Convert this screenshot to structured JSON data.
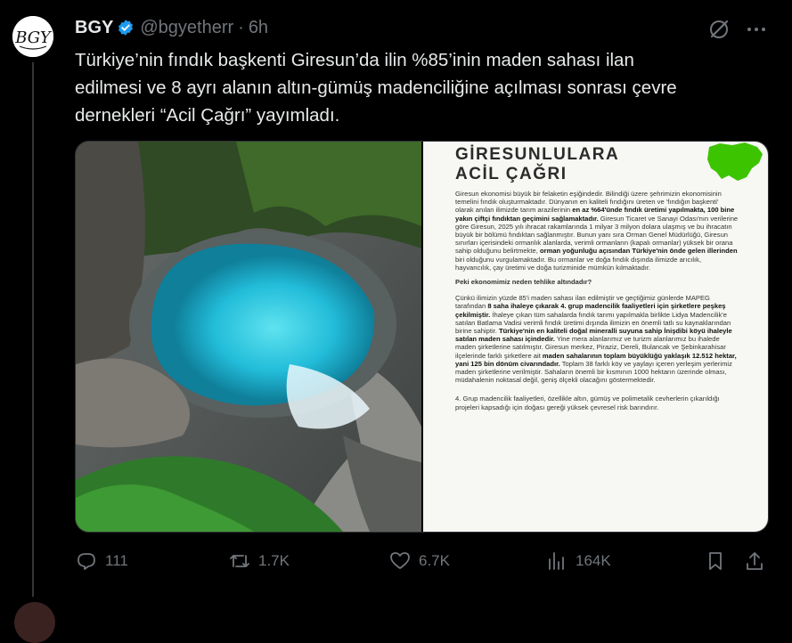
{
  "post": {
    "author_name": "BGY",
    "author_handle": "@bgyetherr",
    "separator": "·",
    "time": "6h",
    "text": "Türkiye’nin fındık başkenti Giresun’da ilin %85’inin maden sahası ilan\nedilmesi ve 8 ayrı alanın altın-gümüş madenciliğine açılması sonrası çevre\ndernekleri “Acil Çağrı” yayımladı.",
    "icons": {
      "grok": "grok-icon",
      "more": "more-icon",
      "verified": "verified-badge-icon"
    }
  },
  "document": {
    "title_line1": "GİRESUNLULARA",
    "title_line2": "ACİL ÇAĞRI",
    "p1_a": "Giresun ekonomisi büyük bir felaketin eşiğindedir. Bilindiği üzere şehrimizin ekonomisinin temelini fındık oluşturmaktadır. Dünyanın en kaliteli fındığını üreten ve 'fındığın başkenti' olarak anılan ilimizde tarım arazilerinin ",
    "p1_b": "en az %64'ünde fındık üretimi yapılmakta, 100 bine yakın çiftçi fındıktan geçimini sağlamaktadır.",
    "p1_c": " Giresun Ticaret ve Sanayi Odası'nın verilerine göre Giresun, 2025 yılı ihracat rakamlarında 1 milyar 3 milyon dolara ulaşmış ve bu ihracatın büyük bir bölümü fındıktan sağlanmıştır. Bunun yanı sıra Orman Genel Müdürlüğü, Giresun sınırları içerisindeki ormanlık alanlarda, verimli ormanların (kapalı ormanlar) yüksek bir orana sahip olduğunu belirtmekte, ",
    "p1_d": "orman yoğunluğu açısından Türkiye'nin önde gelen illerinden",
    "p1_e": " biri olduğunu vurgulamaktadır. Bu ormanlar ve doğa fındık dışında ilimizde arıcılık, hayvancılık, çay üretimi ve doğa turizminide mümkün kılmaktadır.",
    "question": "Peki ekonomimiz neden tehlike altındadır?",
    "p2_a": "Çünkü ilimizin yüzde 85'i maden sahası ilan edilmiştir ve geçtiğimiz günlerde MAPEG tarafından ",
    "p2_b": "8 saha ihaleye çıkarak 4. grup madencilik faaliyetleri için şirketlere peşkeş çekilmiştir.",
    "p2_c": " İhaleye çıkan tüm sahalarda fındık tarımı yapılmakla birlikte Lidya Madencilik'e satılan Batlama Vadisi verimli fındık üretimi dışında ilimizin en önemli tatlı su kaynaklarından birine sahiptir. ",
    "p2_d": "Türkiye'nin en kaliteli doğal mineralli suyuna sahip İnişdibi köyü ihaleyle satılan maden sahası içindedir.",
    "p2_e": " Yine mera alanlarımız ve turizm alanlarımız bu ihalede maden şirketlerine satılmıştır. Giresun merkez, Piraziz, Dereli, Bulancak ve Şebinkarahisar ilçelerinde farklı şirketlere ait ",
    "p2_f": "maden sahalarının toplam büyüklüğü yaklaşık 12.512 hektar, yani 125 bin dönüm civarındadır.",
    "p2_g": " Toplam 38 farklı köy ve yaylayı içeren yerleşim yerlerimiz maden şirketlerine verilmiştir. Sahaların önemli bir kısmının 1000 hektarın üzerinde olması, müdahalenin noktasal değil, geniş ölçekli olacağını göstermektedir.",
    "p3": "4. Grup madencilik faaliyetleri, özellikle altın, gümüş ve polimetalik cevherlerin çıkarıldığı projeleri kapsadığı için doğası gereği yüksek çevresel risk barındırır."
  },
  "actions": {
    "replies": "111",
    "reposts": "1.7K",
    "likes": "6.7K",
    "views": "164K"
  },
  "colors": {
    "background": "#000000",
    "text": "#e7e9ea",
    "muted": "#71767b",
    "verified": "#1d9bf0",
    "map_green": "#3cc400"
  }
}
